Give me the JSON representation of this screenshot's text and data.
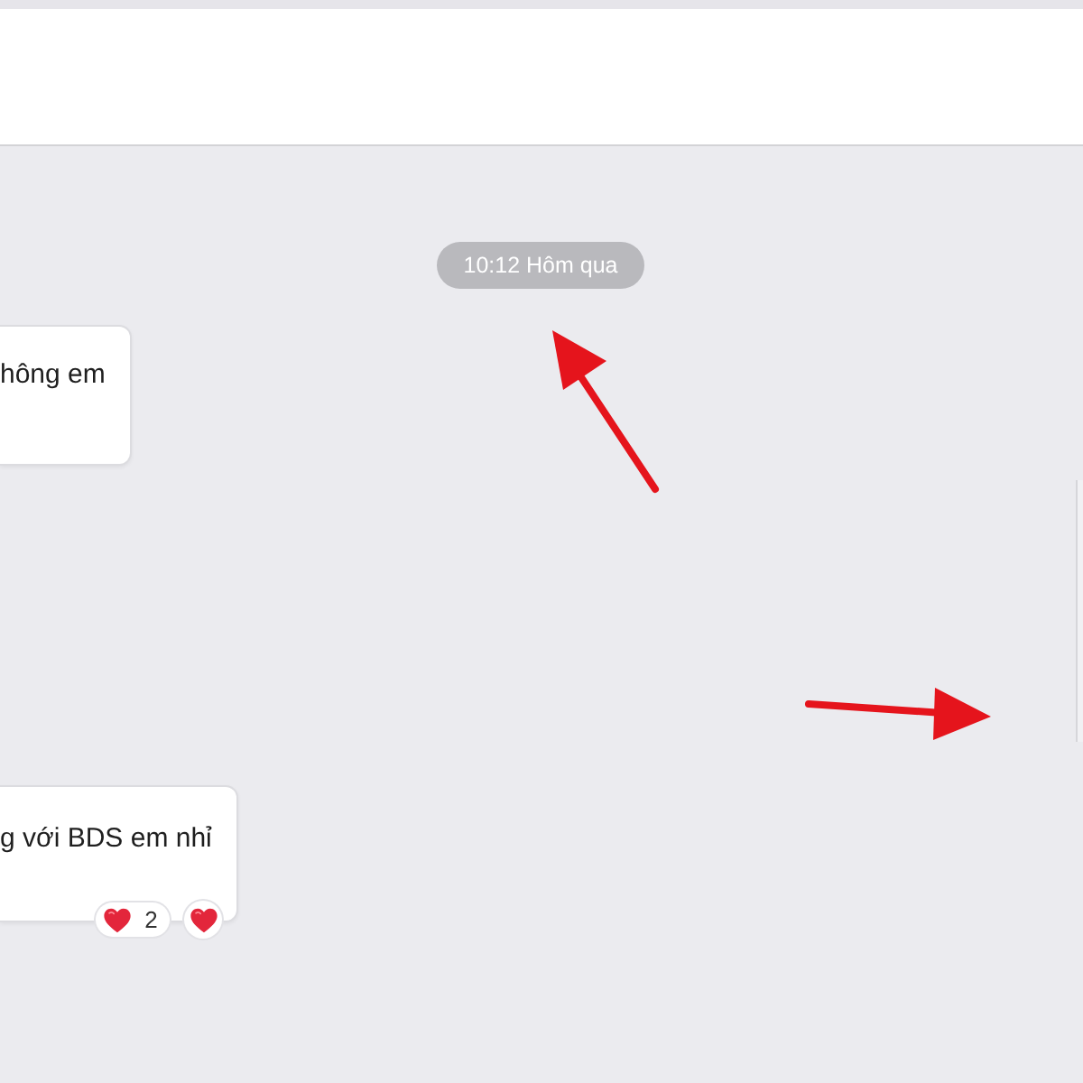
{
  "chat": {
    "timestamp": "10:12 Hôm qua",
    "messages": [
      {
        "text": "hông em"
      },
      {
        "text": "g với BDS em nhỉ",
        "reactions": [
          {
            "kind": "count",
            "count": "2"
          },
          {
            "kind": "single"
          }
        ]
      }
    ]
  }
}
